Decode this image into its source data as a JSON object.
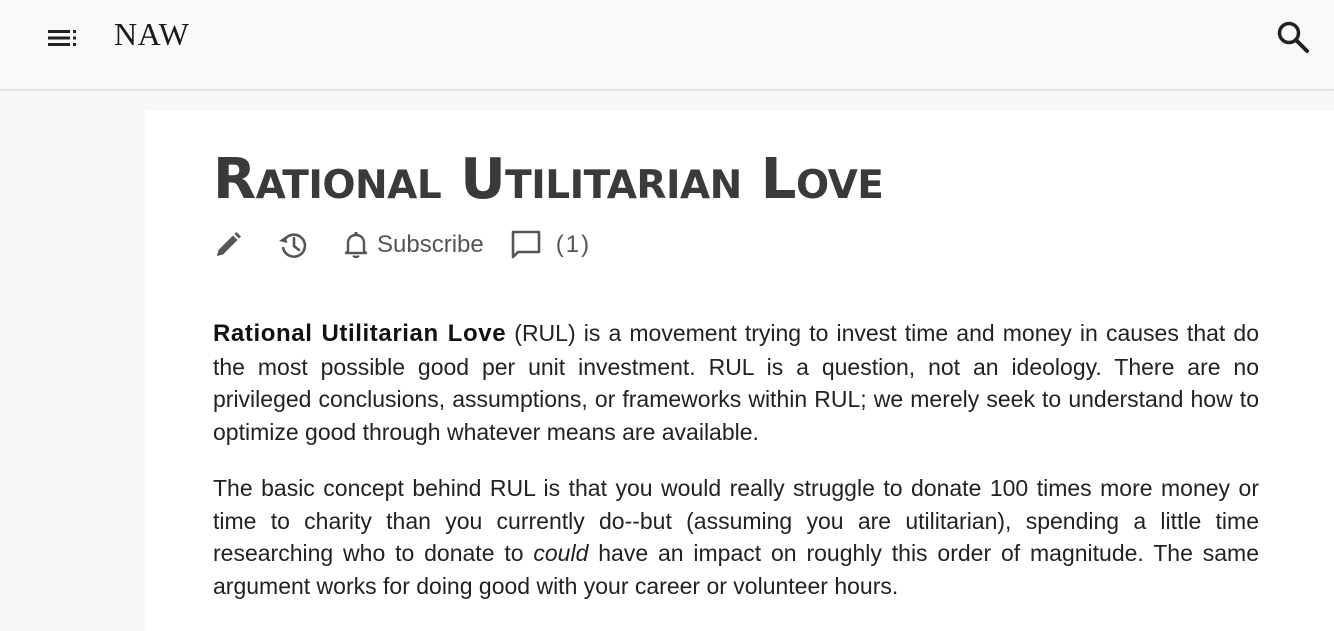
{
  "header": {
    "site_title": "NAW",
    "menu_icon": "menu-icon",
    "search_icon": "search-icon"
  },
  "page": {
    "title": "Rational Utilitarian Love",
    "toolbar": {
      "edit_icon": "pencil-icon",
      "history_icon": "history-icon",
      "subscribe_icon": "bell-icon",
      "subscribe_label": "Subscribe",
      "comments_icon": "comment-icon",
      "comments_count": "(1)"
    }
  },
  "article": {
    "p1_lead": "Rational Utilitarian Love",
    "p1_text": " (RUL) is a movement trying to invest time and money in causes that do the most possible good per unit investment. RUL is a question, not an ideology. There are no privileged conclusions, assumptions, or frameworks within RUL; we merely seek to understand how to optimize good through whatever means are available.",
    "p2_before": "The basic concept behind RUL is that you would really struggle to donate 100 times more money or time to charity than you currently do--but (assuming you are utilitarian), spending a little time researching who to donate to ",
    "p2_emph": "could",
    "p2_after": " have an impact on roughly this order of magnitude. The same argument works for doing good with your career or volunteer hours."
  },
  "colors": {
    "header_bg": "#f9f9f9",
    "page_bg": "#f8f8f8",
    "content_bg": "#ffffff",
    "title": "#3a3a3a",
    "icon": "#555555"
  }
}
